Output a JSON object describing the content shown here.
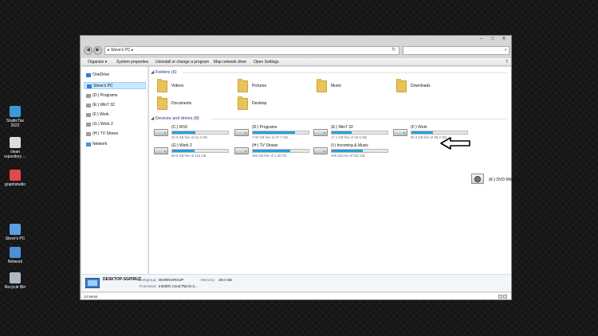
{
  "desktop": {
    "icons": [
      {
        "label": "StudioTax 2022",
        "icon": "studiotax-icon",
        "color": "#3a9ad9"
      },
      {
        "label": "clean repository ...",
        "icon": "document-icon",
        "color": "#dcdcdc"
      },
      {
        "label": "graphstudio",
        "icon": "graphstudio-icon",
        "color": "#e2474a"
      },
      {
        "label": "Steve's PC",
        "icon": "computer-icon",
        "color": "#5aa0e0"
      },
      {
        "label": "Network",
        "icon": "network-icon",
        "color": "#4a8fd8"
      },
      {
        "label": "Recycle Bin",
        "icon": "recycle-bin-icon",
        "color": "#b0b8c4"
      }
    ]
  },
  "window": {
    "controls": {
      "minimize": "–",
      "maximize": "□",
      "close": "✕"
    },
    "nav": {
      "back": "◀",
      "forward": "▶"
    },
    "address": "▸ Steve's PC ▸",
    "refresh": "↻",
    "search_icon": "⌕",
    "toolbar": {
      "organize": "Organize ▾",
      "system_properties": "System properties",
      "uninstall": "Uninstall or change a program",
      "map_drive": "Map network drive",
      "open_settings": "Open Settings",
      "help": "?"
    },
    "navpane": {
      "items": [
        {
          "label": "OneDrive",
          "color": "#2a7fd4"
        },
        {
          "label": "Steve's PC",
          "color": "#3c7fc7"
        },
        {
          "label": "(D:) Programs",
          "color": "#9a9a9a"
        },
        {
          "label": "(E:) Win7 32",
          "color": "#9a9a9a"
        },
        {
          "label": "(F:) Work",
          "color": "#9a9a9a"
        },
        {
          "label": "(G:) Work 2",
          "color": "#9a9a9a"
        },
        {
          "label": "(H:) TV Shows",
          "color": "#9a9a9a"
        },
        {
          "label": "Network",
          "color": "#4a8fd8"
        }
      ],
      "selected_index": 1
    },
    "folders_header": "Folders (6)",
    "folders": [
      {
        "name": "Videos"
      },
      {
        "name": "Pictures"
      },
      {
        "name": "Music"
      },
      {
        "name": "Downloads"
      },
      {
        "name": "Documents"
      },
      {
        "name": "Desktop"
      }
    ],
    "drives_header": "Devices and drives (8)",
    "drives": [
      {
        "name": "(C:) W10",
        "free": "30.3 GB free of 51.3 GB",
        "used_pct": 41
      },
      {
        "name": "(D:) Programs",
        "free": "7.00 GB free of 27.7 GB",
        "used_pct": 75
      },
      {
        "name": "(E:) Win7 32",
        "free": "17.1 GB free of 26.9 GB",
        "used_pct": 36
      },
      {
        "name": "(F:) Work",
        "free": "55.3 GB free of 90.3 GB",
        "used_pct": 39
      },
      {
        "name": "(G:) Work 2",
        "free": "69.6 GB free of 115 GB",
        "used_pct": 40
      },
      {
        "name": "(H:) TV Shows",
        "free": "466 GB free of 1.36 TB",
        "used_pct": 67
      },
      {
        "name": "(I:) Incoming & Music",
        "free": "405 GB free of 931 GB",
        "used_pct": 56
      }
    ],
    "dvd": {
      "name": "(K:) DVD RW Drive"
    },
    "details": {
      "pc_name": "DESKTOP-SGPIRUZ",
      "workgroup_label": "Workgroup:",
      "workgroup": "WORKGROUP",
      "memory_label": "Memory:",
      "memory": "28.0 GB",
      "processor_label": "Processor:",
      "processor": "Intel(R) Core(TM) i5-3..."
    },
    "status": {
      "item_count": "14 items"
    }
  }
}
